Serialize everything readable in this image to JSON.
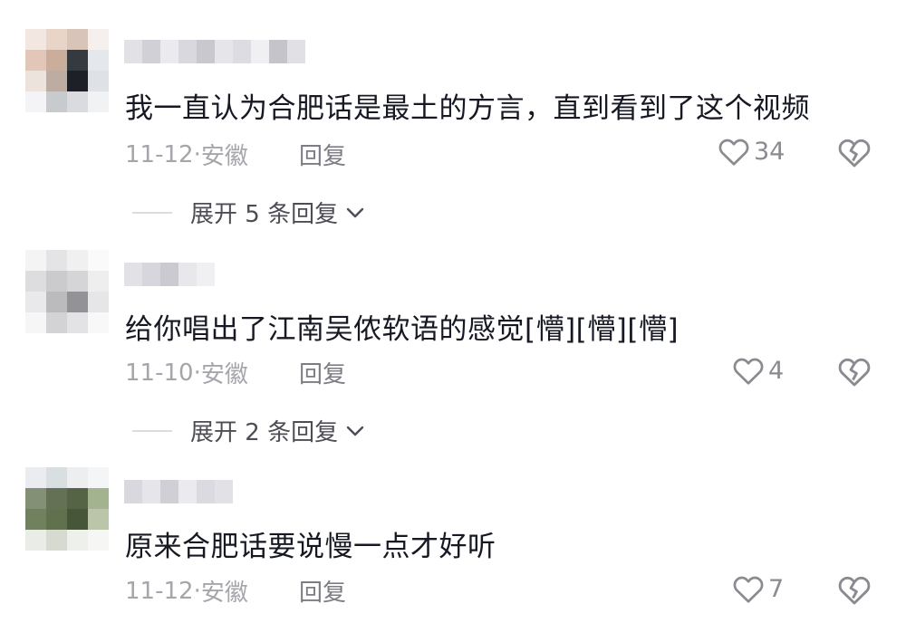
{
  "comments": [
    {
      "text": "我一直认为合肥话是最土的方言，直到看到了这个视频",
      "date": "11-12",
      "location": "安徽",
      "reply_label": "回复",
      "likes": "34",
      "expand_label": "展开 5 条回复",
      "avatar_colors": [
        "#f2e6e0",
        "#e8d3c6",
        "#d7c1b6",
        "#f5f0ee",
        "#e1c4b4",
        "#c9a996",
        "#2b2f36",
        "#e3e6ea",
        "#ece2dc",
        "#b9a89d",
        "#11161c",
        "#dde1e5",
        "#f4f4f6",
        "#c6c9cc",
        "#d7dadd",
        "#f1f2f3"
      ],
      "name_colors": [
        "#e2e2e6",
        "#d0d0d6",
        "#ebebef",
        "#d8d8de",
        "#c8c8ce",
        "#e6e6ea",
        "#dcdce2",
        "#f0f0f3",
        "#c4c4ca",
        "#e0e0e5"
      ]
    },
    {
      "text": "给你唱出了江南吴侬软语的感觉[懵][懵][懵]",
      "date": "11-10",
      "location": "安徽",
      "reply_label": "回复",
      "likes": "4",
      "expand_label": "展开 2 条回复",
      "avatar_colors": [
        "#f4f4f5",
        "#e3e3e5",
        "#f0f0f1",
        "#fafafa",
        "#dcdcde",
        "#c9c9cc",
        "#d3d3d6",
        "#eeeeef",
        "#e8e8ea",
        "#b8b8bb",
        "#8d8d92",
        "#e5e5e7",
        "#f6f6f7",
        "#d1d1d4",
        "#e2e2e4",
        "#f8f8f9"
      ],
      "name_colors": [
        "#e2e2e6",
        "#d6d6dc",
        "#cacad0",
        "#e8e8ec",
        "#f0f0f3"
      ]
    },
    {
      "text": "原来合肥话要说慢一点才好听",
      "date": "11-12",
      "location": "安徽",
      "reply_label": "回复",
      "likes": "7",
      "avatar_colors": [
        "#e9ecef",
        "#d8dde0",
        "#ebeef0",
        "#f4f5f6",
        "#7d8b6e",
        "#5c6a4c",
        "#4c5c3b",
        "#9fae8a",
        "#6a7a57",
        "#596a45",
        "#3e4e2e",
        "#b7c2a6",
        "#e8ebe6",
        "#d4d9cf",
        "#eef0ec",
        "#f6f7f5"
      ],
      "name_colors": [
        "#d8d8de",
        "#e6e6ea",
        "#cfcfd5",
        "#ebebef",
        "#dadae0",
        "#e2e2e6"
      ]
    }
  ],
  "icons": {
    "like": "heart-outline-icon",
    "dislike": "broken-heart-icon",
    "expand": "chevron-down-icon"
  },
  "colors": {
    "text": "#161823",
    "meta": "#a5a5ab",
    "icon": "#8a8a90"
  }
}
